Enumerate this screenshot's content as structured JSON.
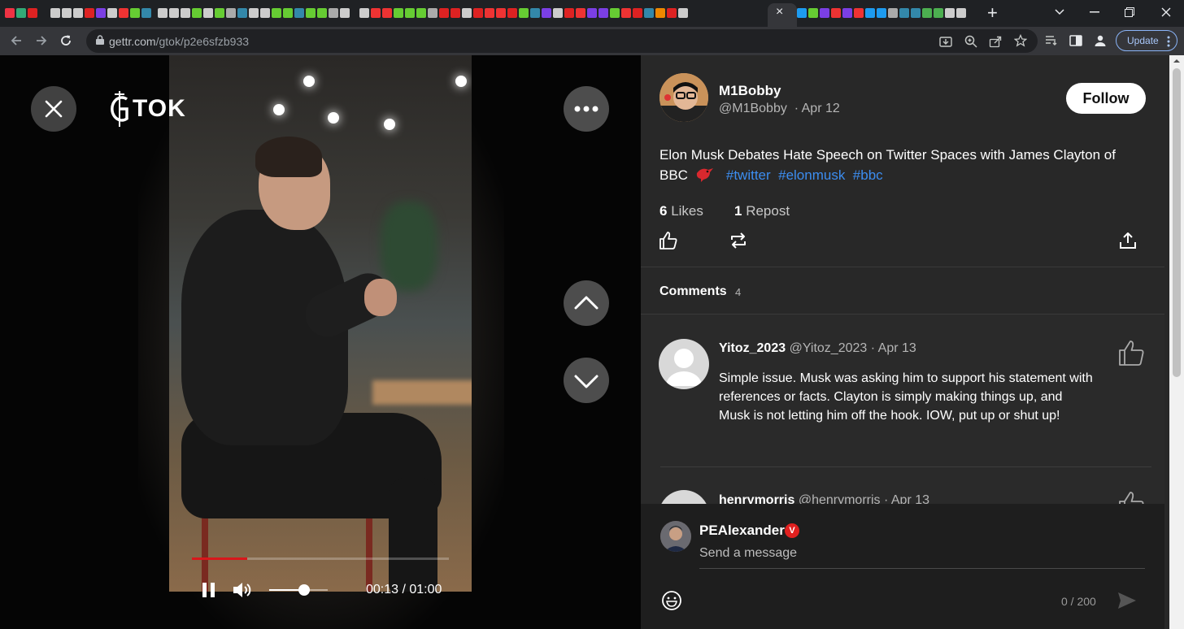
{
  "browser": {
    "url_host": "gettr.com",
    "url_path": "/gtok/p2e6sfzb933",
    "update_label": "Update",
    "tab_close_glyph": "×",
    "new_tab_glyph": "+"
  },
  "player": {
    "logo_text": "TOK",
    "time": "00:13 / 01:00",
    "progress": 0.2167,
    "volume": 0.6
  },
  "post": {
    "author_name": "M1Bobby",
    "author_handle": "@M1Bobby",
    "date": "· Apr 12",
    "follow_label": "Follow",
    "text": "Elon Musk Debates Hate Speech on Twitter Spaces with James Clayton of BBC",
    "hashtags": [
      "#twitter",
      "#elonmusk",
      "#bbc"
    ],
    "likes_count": "6",
    "likes_label": "Likes",
    "reposts_count": "1",
    "reposts_label": "Repost"
  },
  "comments": {
    "title": "Comments",
    "count": "4",
    "items": [
      {
        "name": "Yitoz_2023",
        "handle": "@Yitoz_2023",
        "date": "· Apr 13",
        "text": "Simple issue.  Musk was asking him to support his statement with references or facts.  Clayton is simply making things up, and Musk is not letting him off the hook.  IOW, put up or shut up!"
      },
      {
        "name": "henrymorris",
        "handle": "@henrymorris",
        "date": "· Apr 13"
      }
    ]
  },
  "composer": {
    "user_name": "PEAlexander",
    "verified_glyph": "V",
    "placeholder": "Send a message",
    "char_count": "0 / 200"
  },
  "colors": {
    "accent_hashtag": "#3c8df0",
    "progress_red": "#d8171b",
    "verified_red": "#e0201f"
  }
}
